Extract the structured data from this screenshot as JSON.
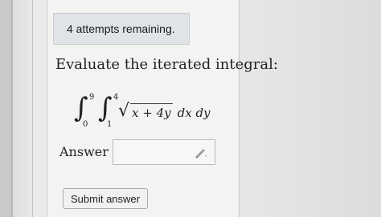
{
  "attempts": {
    "text": "4 attempts remaining."
  },
  "question": {
    "prompt": "Evaluate the iterated integral:"
  },
  "integral": {
    "outer_lower": "0",
    "outer_upper": "9",
    "inner_lower": "1",
    "inner_upper": "4",
    "integrand": "x + 4y",
    "differentials": "dx dy"
  },
  "answer": {
    "label": "Answer :",
    "value": ""
  },
  "submit": {
    "label": "Submit answer"
  },
  "icons": {
    "input_icon": "pencil-icon"
  }
}
